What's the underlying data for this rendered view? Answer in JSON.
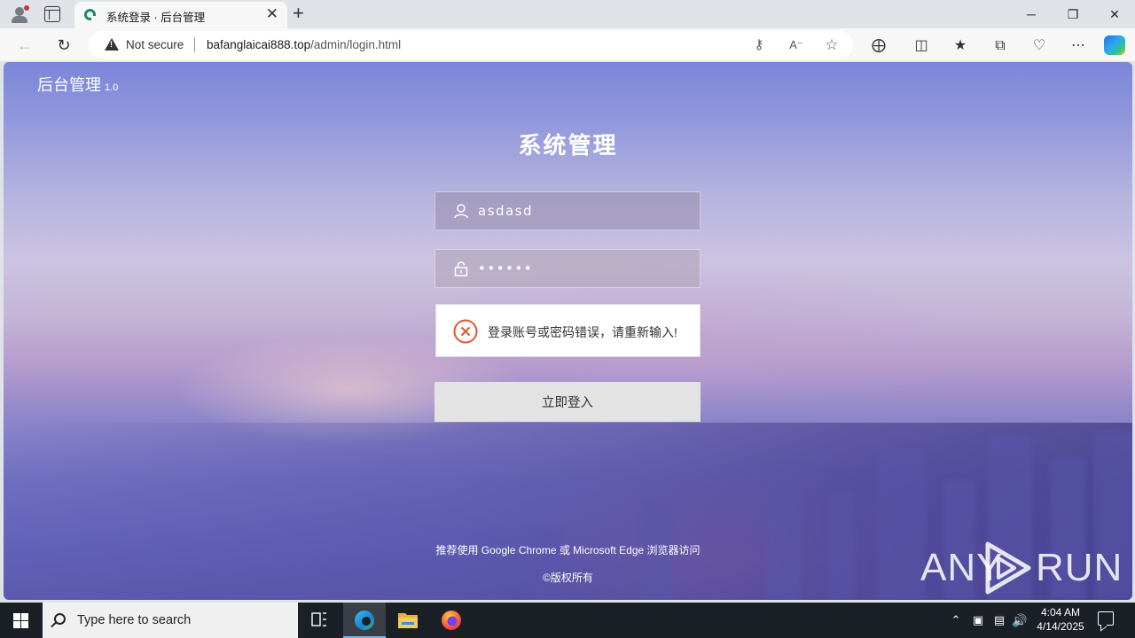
{
  "browser": {
    "tab_title": "系统登录 · 后台管理",
    "tab_close": "✕",
    "new_tab": "+",
    "security_label": "Not secure",
    "url_host": "bafanglaicai888.top",
    "url_path": "/admin/login.html",
    "window": {
      "minimize": "─",
      "restore": "❐",
      "close": "✕"
    }
  },
  "page": {
    "brand": "后台管理",
    "brand_version": "1.0",
    "title": "系统管理",
    "username_value": "asdasd",
    "password_value": "••••••",
    "error_message": "登录账号或密码错误，请重新输入!",
    "submit_label": "立即登入",
    "footer_browser_hint": "推荐使用 Google Chrome 或 Microsoft Edge 浏览器访问",
    "footer_copyright": "©版权所有",
    "watermark_left": "ANY",
    "watermark_right": "RUN"
  },
  "taskbar": {
    "search_placeholder": "Type here to search",
    "time": "4:04 AM",
    "date": "4/14/2025"
  },
  "colors": {
    "error_icon": "#e8532f",
    "copilot_accent": "#1b73e8",
    "taskbar_bg": "#1b1f26"
  }
}
